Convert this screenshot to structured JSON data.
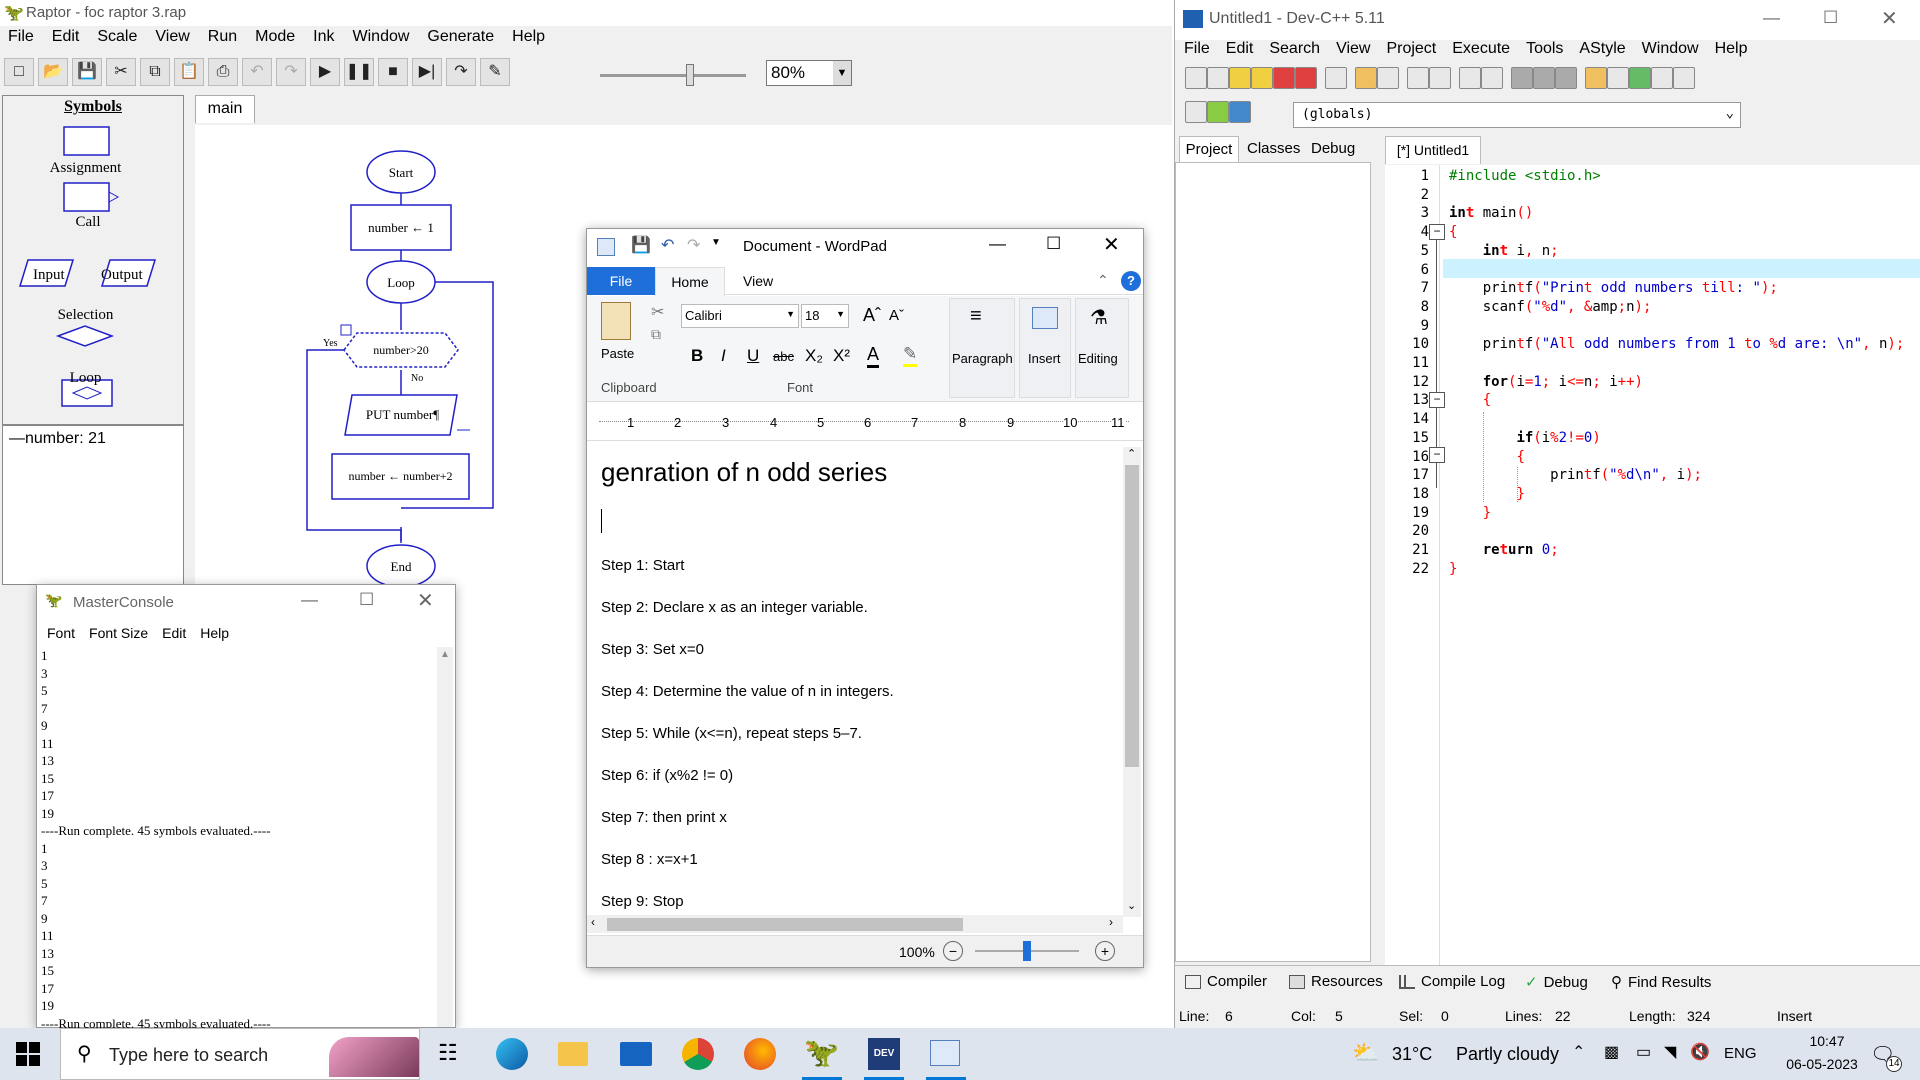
{
  "raptor": {
    "title": "Raptor - foc raptor 3.rap",
    "menu": [
      "File",
      "Edit",
      "Scale",
      "View",
      "Run",
      "Mode",
      "Ink",
      "Window",
      "Generate",
      "Help"
    ],
    "zoom": "80%",
    "symbols_heading": "Symbols",
    "symbols": [
      "Assignment",
      "Call",
      "Input",
      "Output",
      "Selection",
      "Loop"
    ],
    "tab": "main",
    "variable": "number: 21",
    "flow": {
      "start": "Start",
      "assign1": "number ← 1",
      "loop": "Loop",
      "cond": "number>20",
      "yes": "Yes",
      "no": "No",
      "output": "PUT number¶",
      "assign2": "number ← number+2",
      "end": "End"
    }
  },
  "console": {
    "title": "MasterConsole",
    "menu": [
      "Font",
      "Font Size",
      "Edit",
      "Help"
    ],
    "lines": [
      "1",
      "3",
      "5",
      "7",
      "9",
      "11",
      "13",
      "15",
      "17",
      "19",
      "----Run complete.  45 symbols evaluated.----",
      "1",
      "3",
      "5",
      "7",
      "9",
      "11",
      "13",
      "15",
      "17",
      "19",
      "----Run complete.  45 symbols evaluated.----"
    ]
  },
  "wordpad": {
    "title": "Document - WordPad",
    "tabs": [
      "File",
      "Home",
      "View"
    ],
    "font_name": "Calibri",
    "font_size": "18",
    "groups": {
      "clipboard": "Clipboard",
      "font": "Font",
      "paste": "Paste",
      "paragraph": "Paragraph",
      "insert": "Insert",
      "editing": "Editing"
    },
    "ruler": [
      "1",
      "2",
      "3",
      "4",
      "5",
      "6",
      "7",
      "8",
      "9",
      "10",
      "11"
    ],
    "heading": "genration of n odd series",
    "steps": [
      "Step 1: Start",
      "Step 2: Declare x as an integer variable.",
      "Step 3: Set x=0",
      "Step 4: Determine the value of n in integers.",
      "Step 5: While (x<=n), repeat steps 5–7.",
      "Step 6: if (x%2 != 0)",
      "Step 7: then print x",
      "Step 8 : x=x+1",
      "Step 9: Stop"
    ],
    "zoom": "100%",
    "zoom_level": 0.5
  },
  "devcpp": {
    "title": "Untitled1 - Dev-C++ 5.11",
    "menu": [
      "File",
      "Edit",
      "Search",
      "View",
      "Project",
      "Execute",
      "Tools",
      "AStyle",
      "Window",
      "Help"
    ],
    "scope": "(globals)",
    "left_tabs": [
      "Project",
      "Classes",
      "Debug"
    ],
    "file_tab": "[*] Untitled1",
    "code": [
      "#include <stdio.h>",
      "",
      "int main()",
      "{",
      "    int i, n;",
      "",
      "    printf(\"Print odd numbers till: \");",
      "    scanf(\"%d\", &n);",
      "",
      "    printf(\"All odd numbers from 1 to %d are: \\n\", n);",
      "",
      "    for(i=1; i<=n; i++)",
      "    {",
      "",
      "        if(i%2!=0)",
      "        {",
      "            printf(\"%d\\n\", i);",
      "        }",
      "    }",
      "",
      "    return 0;",
      "}"
    ],
    "bottom_tabs": [
      "Compiler",
      "Resources",
      "Compile Log",
      "Debug",
      "Find Results"
    ],
    "status": {
      "line": "Line:",
      "line_v": "6",
      "col": "Col:",
      "col_v": "5",
      "sel": "Sel:",
      "sel_v": "0",
      "lines": "Lines:",
      "lines_v": "22",
      "length": "Length:",
      "length_v": "324",
      "mode": "Insert"
    }
  },
  "taskbar": {
    "search": "Type here to search",
    "weather_temp": "31°C",
    "weather_desc": "Partly cloudy",
    "lang": "ENG",
    "time": "10:47",
    "date": "06-05-2023",
    "notifications": "14"
  },
  "colors": {
    "flow_blue": "#2020c8",
    "accent": "#0078d7",
    "code_green": "#008000",
    "code_blue": "#0000cc",
    "code_red": "#ff0000",
    "highlight_line": "#ccf2ff"
  }
}
